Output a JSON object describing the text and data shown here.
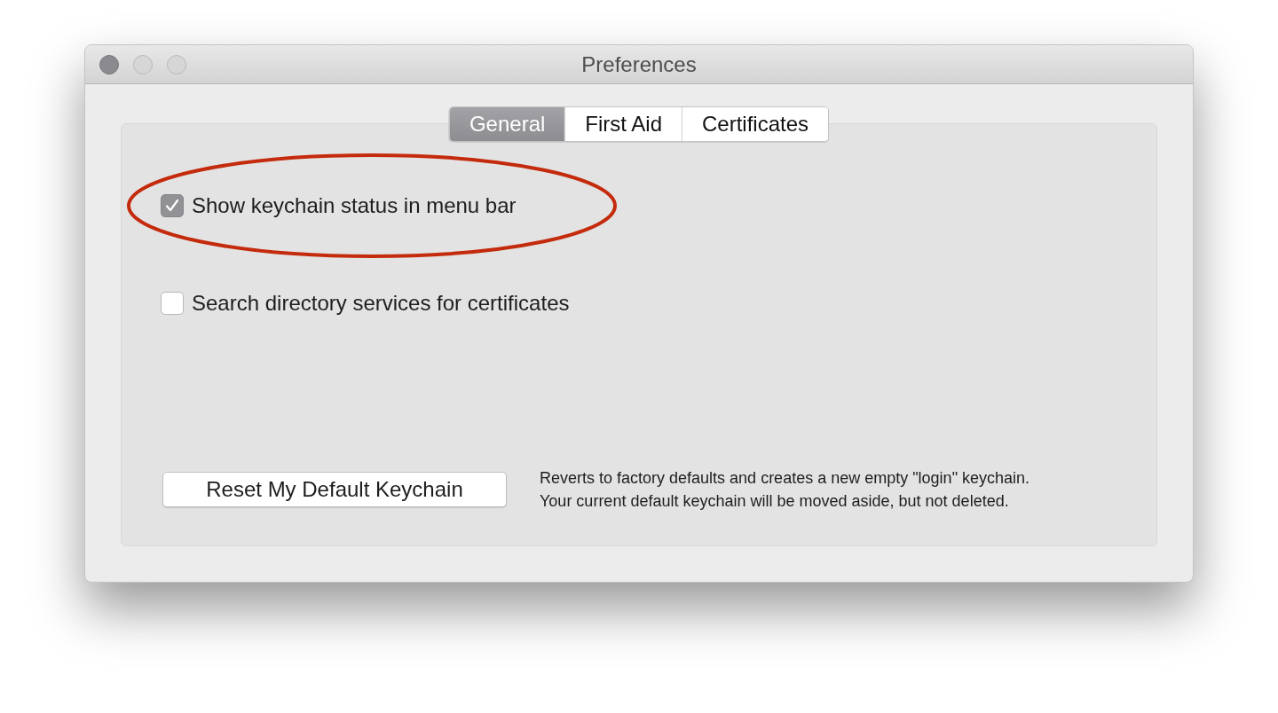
{
  "window": {
    "title": "Preferences"
  },
  "tabs": [
    {
      "label": "General",
      "selected": true
    },
    {
      "label": "First Aid",
      "selected": false
    },
    {
      "label": "Certificates",
      "selected": false
    }
  ],
  "options": [
    {
      "label": "Show keychain status in menu bar",
      "checked": true,
      "highlighted": true
    },
    {
      "label": "Search directory services for certificates",
      "checked": false,
      "highlighted": false
    }
  ],
  "reset": {
    "button": "Reset My Default Keychain",
    "description": [
      "Reverts to factory defaults and creates a new empty \"login\" keychain.",
      "Your current default keychain will be moved aside, but not deleted."
    ]
  }
}
